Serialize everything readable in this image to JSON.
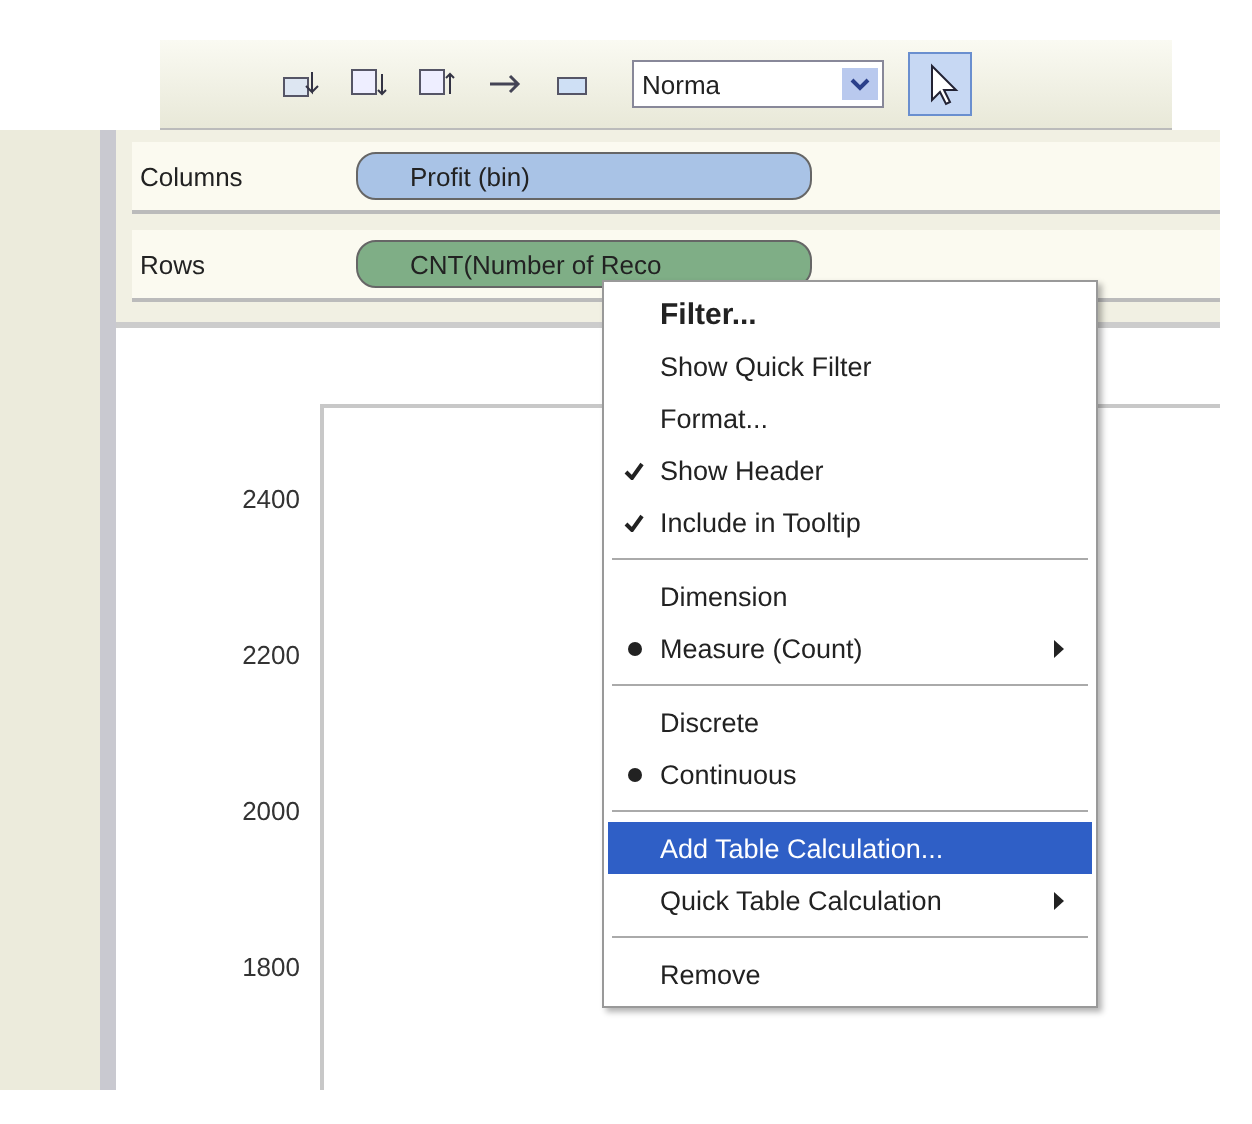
{
  "toolbar": {
    "view_dropdown": "Norma",
    "pointer_selected": true
  },
  "shelves": [
    {
      "label": "Columns",
      "pill": "Profit (bin)",
      "kind": "dimension"
    },
    {
      "label": "Rows",
      "pill": "CNT(Number of Reco",
      "kind": "measure"
    }
  ],
  "axis": {
    "labels": [
      "2400",
      "2200",
      "2000",
      "1800"
    ]
  },
  "context_menu": {
    "items": [
      {
        "kind": "item",
        "label": "Filter...",
        "checked": false,
        "radio": false,
        "default": true,
        "selected": false,
        "submenu": false
      },
      {
        "kind": "item",
        "label": "Show Quick Filter",
        "checked": false,
        "radio": false,
        "default": false,
        "selected": false,
        "submenu": false
      },
      {
        "kind": "item",
        "label": "Format...",
        "checked": false,
        "radio": false,
        "default": false,
        "selected": false,
        "submenu": false
      },
      {
        "kind": "item",
        "label": "Show Header",
        "checked": true,
        "radio": false,
        "default": false,
        "selected": false,
        "submenu": false
      },
      {
        "kind": "item",
        "label": "Include in Tooltip",
        "checked": true,
        "radio": false,
        "default": false,
        "selected": false,
        "submenu": false
      },
      {
        "kind": "separator"
      },
      {
        "kind": "item",
        "label": "Dimension",
        "checked": false,
        "radio": false,
        "default": false,
        "selected": false,
        "submenu": false
      },
      {
        "kind": "item",
        "label": "Measure (Count)",
        "checked": false,
        "radio": true,
        "default": false,
        "selected": false,
        "submenu": true
      },
      {
        "kind": "separator"
      },
      {
        "kind": "item",
        "label": "Discrete",
        "checked": false,
        "radio": false,
        "default": false,
        "selected": false,
        "submenu": false
      },
      {
        "kind": "item",
        "label": "Continuous",
        "checked": false,
        "radio": true,
        "default": false,
        "selected": false,
        "submenu": false
      },
      {
        "kind": "separator"
      },
      {
        "kind": "item",
        "label": "Add Table Calculation...",
        "checked": false,
        "radio": false,
        "default": false,
        "selected": true,
        "submenu": false
      },
      {
        "kind": "item",
        "label": "Quick Table Calculation",
        "checked": false,
        "radio": false,
        "default": false,
        "selected": false,
        "submenu": true
      },
      {
        "kind": "separator"
      },
      {
        "kind": "item",
        "label": "Remove",
        "checked": false,
        "radio": false,
        "default": false,
        "selected": false,
        "submenu": false
      }
    ]
  }
}
